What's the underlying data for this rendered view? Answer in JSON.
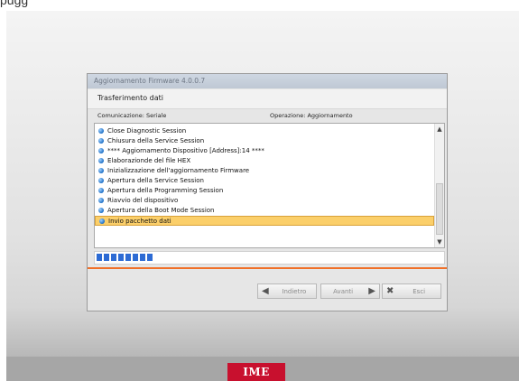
{
  "top_text": "pugg",
  "dialog": {
    "title": "Aggiornamento Firmware 4.0.0.7",
    "subtitle": "Trasferimento dati",
    "communication_label": "Comunicazione: Seriale",
    "operation_label": "Operazione: Aggiornamento"
  },
  "log_items": [
    "Close Diagnostic Session",
    "Chiusura della Service Session",
    "**** Aggiornamento Dispositivo [Address]:14 ****",
    "Elaborazionde del file HEX",
    "Inizializzazione dell'aggiornamento Firmware",
    "Apertura della Service Session",
    "Apertura della Programming Session",
    "Riavvio del dispositivo",
    "Apertura della Boot Mode Session",
    "Invio pacchetto dati"
  ],
  "selected_index": 9,
  "progress": {
    "blocks_filled": 8
  },
  "buttons": {
    "back_label": "Indietro",
    "next_label": "Avanti",
    "exit_label": "Esci"
  },
  "icons": {
    "back": "arrow-left-icon",
    "next": "arrow-right-icon",
    "exit": "close-x-icon"
  },
  "logo_text": "IME",
  "colors": {
    "accent_orange": "#f07028",
    "selection": "#fbcf6a",
    "progress_blue": "#2d6bd4",
    "logo_red": "#c8102e"
  }
}
